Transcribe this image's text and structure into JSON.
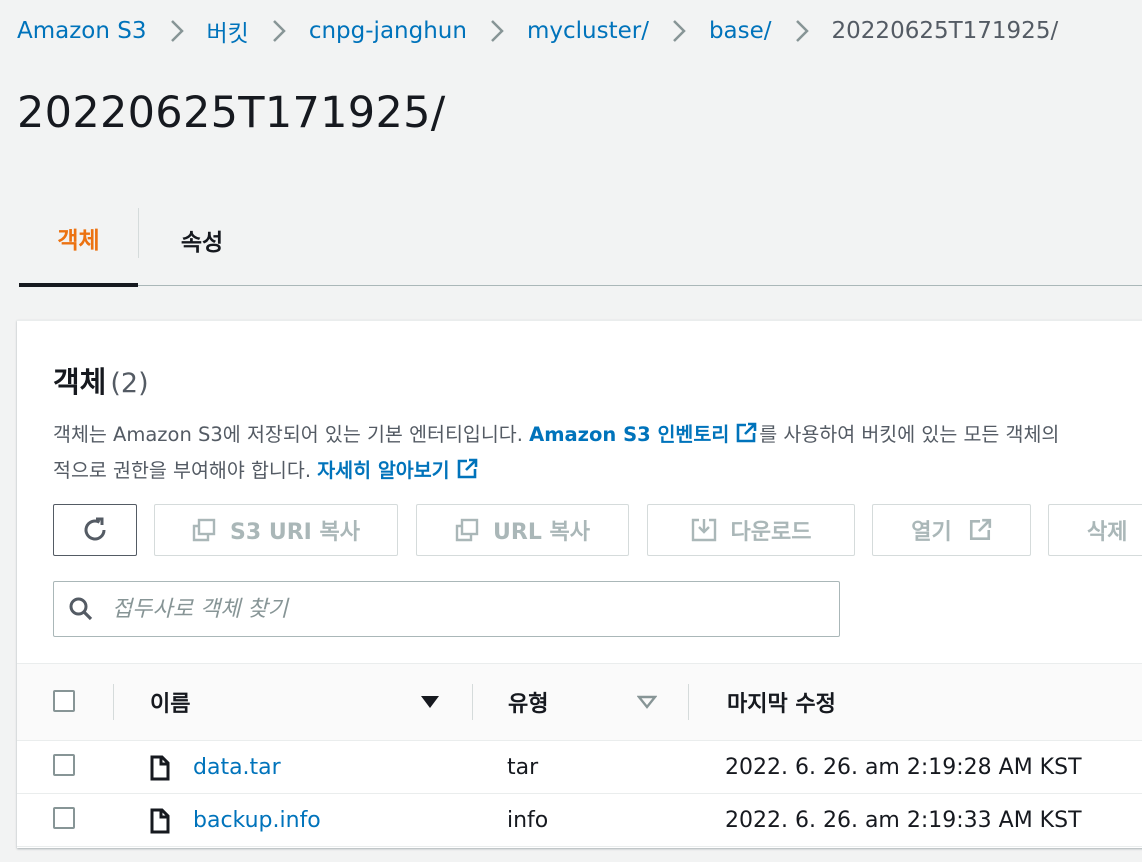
{
  "breadcrumb": [
    {
      "label": "Amazon S3",
      "current": false
    },
    {
      "label": "버킷",
      "current": false
    },
    {
      "label": "cnpg-janghun",
      "current": false
    },
    {
      "label": "mycluster/",
      "current": false
    },
    {
      "label": "base/",
      "current": false
    },
    {
      "label": "20220625T171925/",
      "current": true
    }
  ],
  "page_title": "20220625T171925/",
  "tabs": [
    {
      "label": "객체",
      "active": true
    },
    {
      "label": "속성",
      "active": false
    }
  ],
  "panel": {
    "title": "객체",
    "count": "(2)",
    "desc_line1_a": "객체는 Amazon S3에 저장되어 있는 기본 엔터티입니다. ",
    "desc_link1": "Amazon S3 인벤토리",
    "desc_line1_b": "를 사용하여 버킷에 있는 모든 객체의",
    "desc_line2_a": "적으로 권한을 부여해야 합니다. ",
    "desc_link2": "자세히 알아보기"
  },
  "toolbar": {
    "copy_s3_uri": "S3 URI 복사",
    "copy_url": "URL 복사",
    "download": "다운로드",
    "open": "열기",
    "delete": "삭제"
  },
  "search": {
    "placeholder": "접두사로 객체 찾기"
  },
  "table": {
    "columns": [
      "이름",
      "유형",
      "마지막 수정"
    ],
    "rows": [
      {
        "name": "data.tar",
        "type": "tar",
        "modified": "2022. 6. 26. am 2:19:28 AM KST"
      },
      {
        "name": "backup.info",
        "type": "info",
        "modified": "2022. 6. 26. am 2:19:33 AM KST"
      }
    ]
  },
  "colors": {
    "link": "#0073bb",
    "active_tab": "#ec7211",
    "disabled": "#aab7b8"
  }
}
